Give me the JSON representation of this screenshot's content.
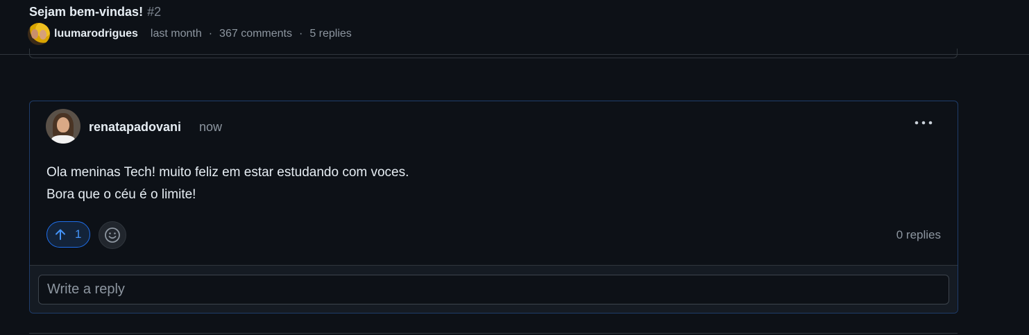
{
  "header": {
    "title": "Sejam bem-vindas!",
    "number": "#2",
    "author": "luumarodrigues",
    "time": "last month",
    "separator": "·",
    "comments": "367 comments",
    "replies": "5 replies"
  },
  "comment": {
    "author": "renatapadovani",
    "time": "now",
    "more_icon": "kebab-horizontal-icon",
    "body_lines": [
      "Ola meninas Tech! muito feliz em estar estudando com voces.",
      "Bora que o céu é o limite!"
    ],
    "upvote_icon": "arrow-up-icon",
    "upvote_count": "1",
    "reaction_icon": "smiley-icon",
    "replies_count": "0 replies",
    "reply_placeholder": "Write a reply"
  },
  "colors": {
    "background": "#0d1117",
    "accent_blue": "#4493f8",
    "border": "#30363d",
    "muted_text": "#8d96a0"
  }
}
